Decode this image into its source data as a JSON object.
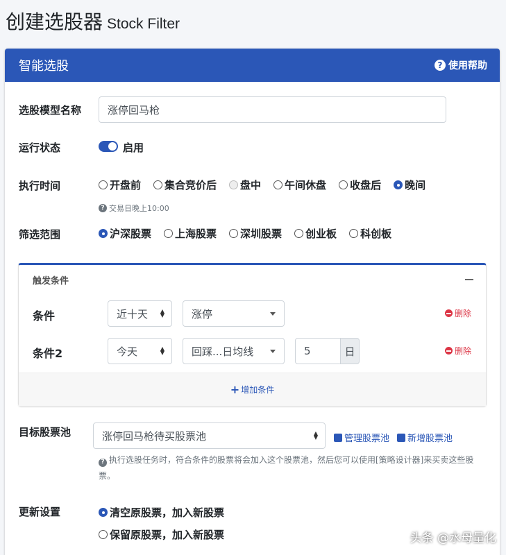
{
  "page": {
    "title_cn": "创建选股器",
    "title_en": "Stock Filter"
  },
  "card": {
    "title": "智能选股",
    "help_label": "使用帮助"
  },
  "form": {
    "model_name_label": "选股模型名称",
    "model_name_value": "涨停回马枪",
    "status_label": "运行状态",
    "status_value": "启用",
    "status_enabled": true,
    "exec_time_label": "执行时间",
    "exec_time_options": [
      {
        "label": "开盘前",
        "checked": false,
        "disabled": false
      },
      {
        "label": "集合竞价后",
        "checked": false,
        "disabled": false
      },
      {
        "label": "盘中",
        "checked": false,
        "disabled": true
      },
      {
        "label": "午间休盘",
        "checked": false,
        "disabled": false
      },
      {
        "label": "收盘后",
        "checked": false,
        "disabled": false
      },
      {
        "label": "晚间",
        "checked": true,
        "disabled": false
      }
    ],
    "exec_time_hint": "交易日晚上10:00",
    "scope_label": "筛选范围",
    "scope_options": [
      {
        "label": "沪深股票",
        "checked": true
      },
      {
        "label": "上海股票",
        "checked": false
      },
      {
        "label": "深圳股票",
        "checked": false
      },
      {
        "label": "创业板",
        "checked": false
      },
      {
        "label": "科创板",
        "checked": false
      }
    ]
  },
  "conditions": {
    "header": "触发条件",
    "items": [
      {
        "label": "条件",
        "period": "近十天",
        "type": "涨停",
        "delete_label": "删除"
      },
      {
        "label": "条件2",
        "period": "今天",
        "type": "回踩...日均线",
        "number": "5",
        "unit": "日",
        "delete_label": "删除"
      }
    ],
    "add_label": "增加条件"
  },
  "pool": {
    "label": "目标股票池",
    "selected": "涨停回马枪待买股票池",
    "manage_label": "管理股票池",
    "new_label": "新增股票池",
    "hint": "执行选股任务时，符合条件的股票将会加入这个股票池，然后您可以使用[策略设计器]来买卖这些股票。"
  },
  "update": {
    "label": "更新设置",
    "options": [
      {
        "label": "清空原股票，加入新股票",
        "checked": true
      },
      {
        "label": "保留原股票，加入新股票",
        "checked": false
      }
    ]
  },
  "watermark": "头条 @水母量化",
  "colors": {
    "primary": "#2b57b7",
    "danger": "#dc3545",
    "muted": "#6c757d"
  }
}
